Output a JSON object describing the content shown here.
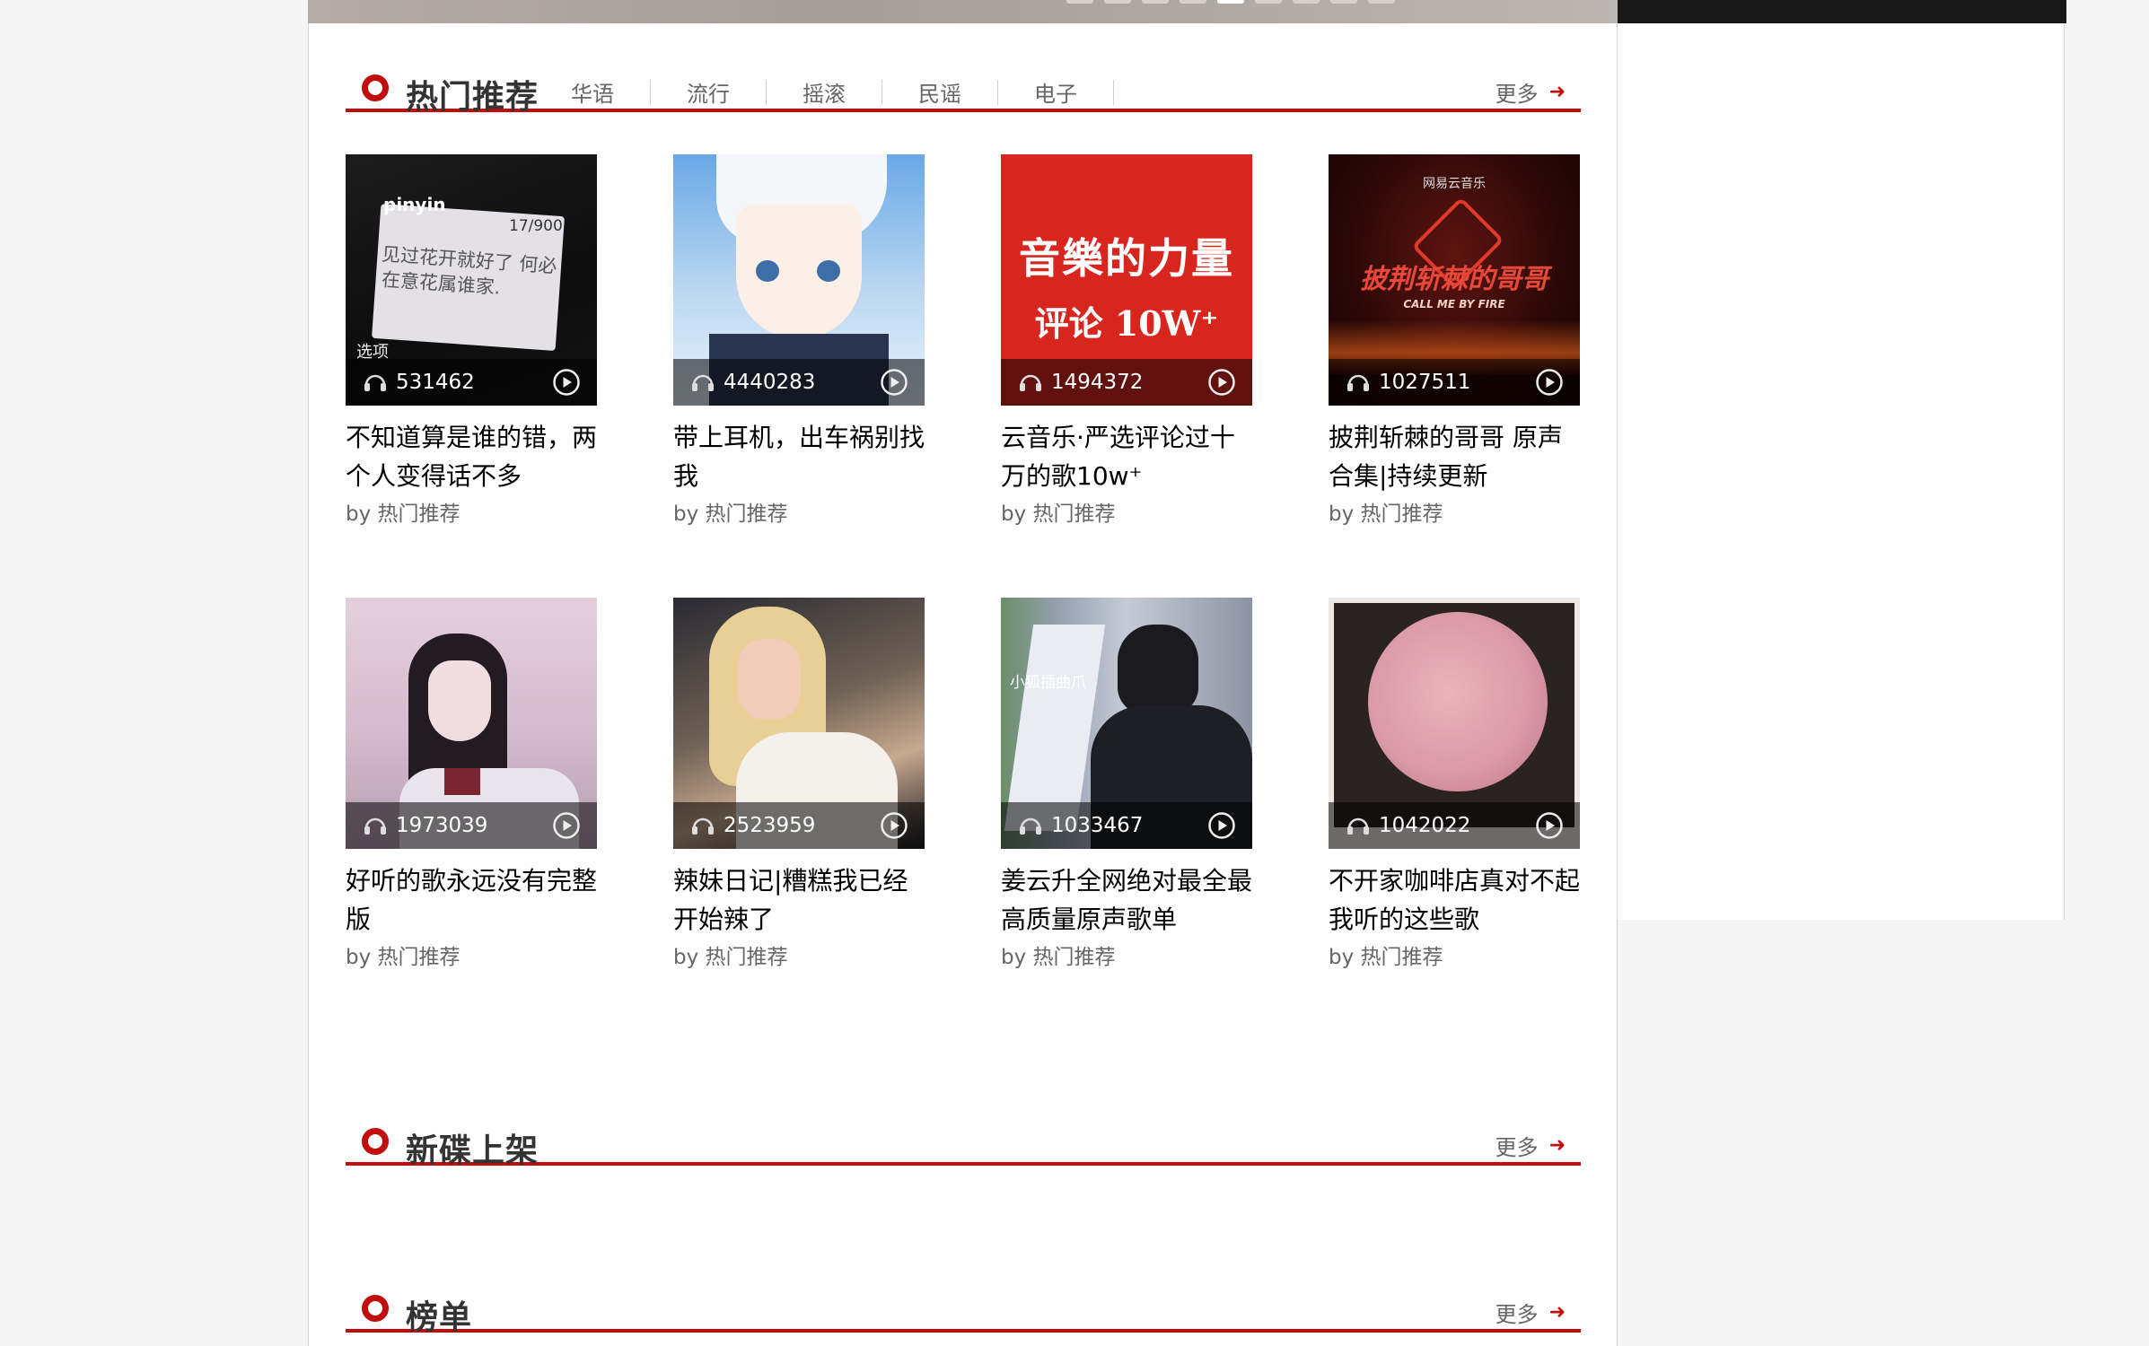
{
  "banner": {
    "dot_count": 10,
    "active_dot": 5
  },
  "sections": {
    "hot": {
      "title": "热门推荐",
      "tabs": [
        "华语",
        "流行",
        "摇滚",
        "民谣",
        "电子"
      ],
      "more": "更多"
    },
    "new_albums": {
      "title": "新碟上架",
      "more": "更多"
    },
    "charts": {
      "title": "榜单",
      "more": "更多"
    }
  },
  "playlists": [
    {
      "count": "531462",
      "title": "不知道算是谁的错，两个人变得话不多",
      "by": "by 热门推荐",
      "cover_text": [
        "pinyin",
        "17/900",
        "见过花开就好了 何必",
        "在意花属谁家.",
        "选项"
      ]
    },
    {
      "count": "4440283",
      "title": "带上耳机，出车祸别找我",
      "by": "by 热门推荐"
    },
    {
      "count": "1494372",
      "title": "云音乐·严选评论过十万的歌10w⁺",
      "by": "by 热门推荐",
      "cover_text": [
        "音樂的力量",
        "评论 10W⁺"
      ]
    },
    {
      "count": "1027511",
      "title": "披荆斩棘的哥哥 原声合集|持续更新",
      "by": "by 热门推荐",
      "cover_text": [
        "网易云音乐",
        "披荆斩棘的哥哥",
        "CALL ME BY FIRE"
      ]
    },
    {
      "count": "1973039",
      "title": "好听的歌永远没有完整版",
      "by": "by 热门推荐"
    },
    {
      "count": "2523959",
      "title": "辣妹日记|糟糕我已经开始辣了",
      "by": "by 热门推荐"
    },
    {
      "count": "1033467",
      "title": "姜云升全网绝对最全最高质量原声歌单",
      "by": "by 热门推荐",
      "cover_text": [
        "小狐插曲爪"
      ]
    },
    {
      "count": "1042022",
      "title": "不开家咖啡店真对不起我听的这些歌",
      "by": "by 热门推荐"
    }
  ],
  "colors": {
    "accent": "#c10d0c",
    "text": "#333333",
    "muted": "#666666"
  },
  "icons": {
    "headphone": "headphone-icon",
    "play": "play-circle-icon",
    "arrow": "arrow-right-icon",
    "section": "ring-icon"
  }
}
